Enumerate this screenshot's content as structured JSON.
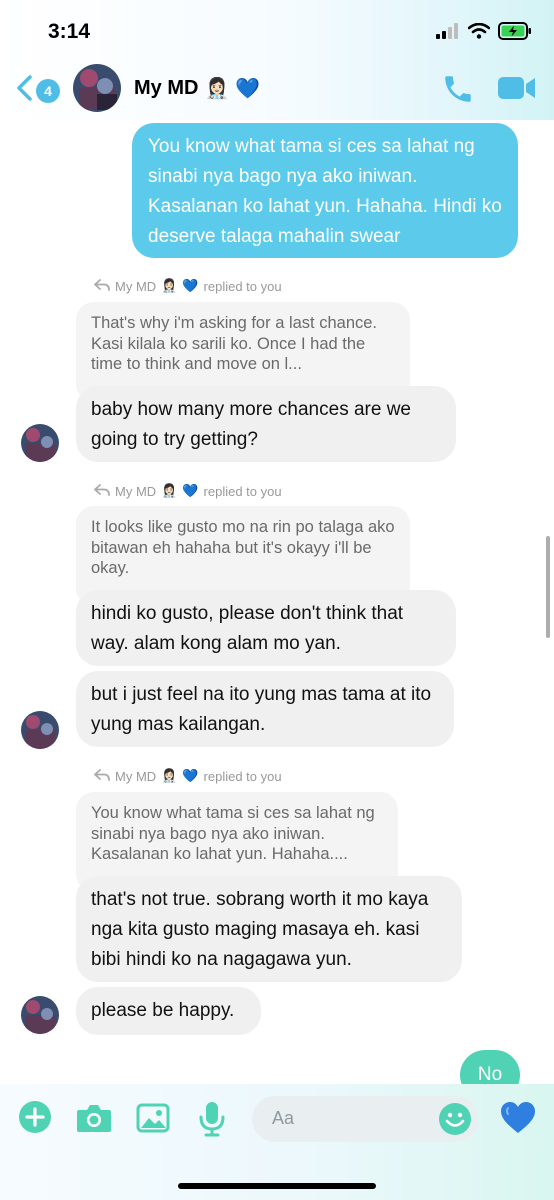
{
  "status_bar": {
    "time": "3:14"
  },
  "header": {
    "back_badge": "4",
    "contact_name": "My MD",
    "name_emoji": "👩🏻‍⚕️",
    "name_heart": "💙"
  },
  "messages": {
    "m1": "You know what tama si ces sa lahat ng sinabi nya bago nya ako iniwan. Kasalanan ko lahat yun. Hahaha. Hindi ko deserve talaga mahalin swear",
    "r1": {
      "name": "My MD",
      "emoji": "👩🏻‍⚕️",
      "heart": "💙",
      "suffix": "replied to you"
    },
    "q1": "That's why i'm asking for a last chance. Kasi kilala ko sarili ko. Once I had the time to think and move on l...",
    "m2": "baby how many more chances are we going to try getting?",
    "r2": {
      "name": "My MD",
      "emoji": "👩🏻‍⚕️",
      "heart": "💙",
      "suffix": "replied to you"
    },
    "q2": "It looks like gusto mo na rin po talaga ako bitawan eh hahaha but it's okayy i'll be okay.",
    "m3": "hindi ko gusto, please don't think that way. alam kong alam mo yan.",
    "m4": "but i just feel na ito yung mas tama at ito yung mas kailangan.",
    "r3": {
      "name": "My MD",
      "emoji": "👩🏻‍⚕️",
      "heart": "💙",
      "suffix": "replied to you"
    },
    "q3": "You know what tama si ces sa lahat ng sinabi nya bago nya ako iniwan. Kasalanan ko lahat yun. Hahaha....",
    "m5": "that's not true. sobrang worth it mo kaya nga kita gusto maging masaya eh. kasi bibi hindi ko na nagagawa yun.",
    "m6": "please be happy.",
    "m7": "No"
  },
  "composer": {
    "placeholder": "Aa",
    "like_heart": "💙"
  },
  "colors": {
    "accent": "#4fbde6",
    "outgoing": "#5ccaea",
    "composer_icons": "#50d3b4",
    "incoming": "#f0f0f0"
  },
  "icons": [
    "back-chevron-icon",
    "phone-icon",
    "video-camera-icon",
    "plus-icon",
    "camera-icon",
    "image-icon",
    "microphone-icon",
    "emoji-icon",
    "heart-icon"
  ]
}
